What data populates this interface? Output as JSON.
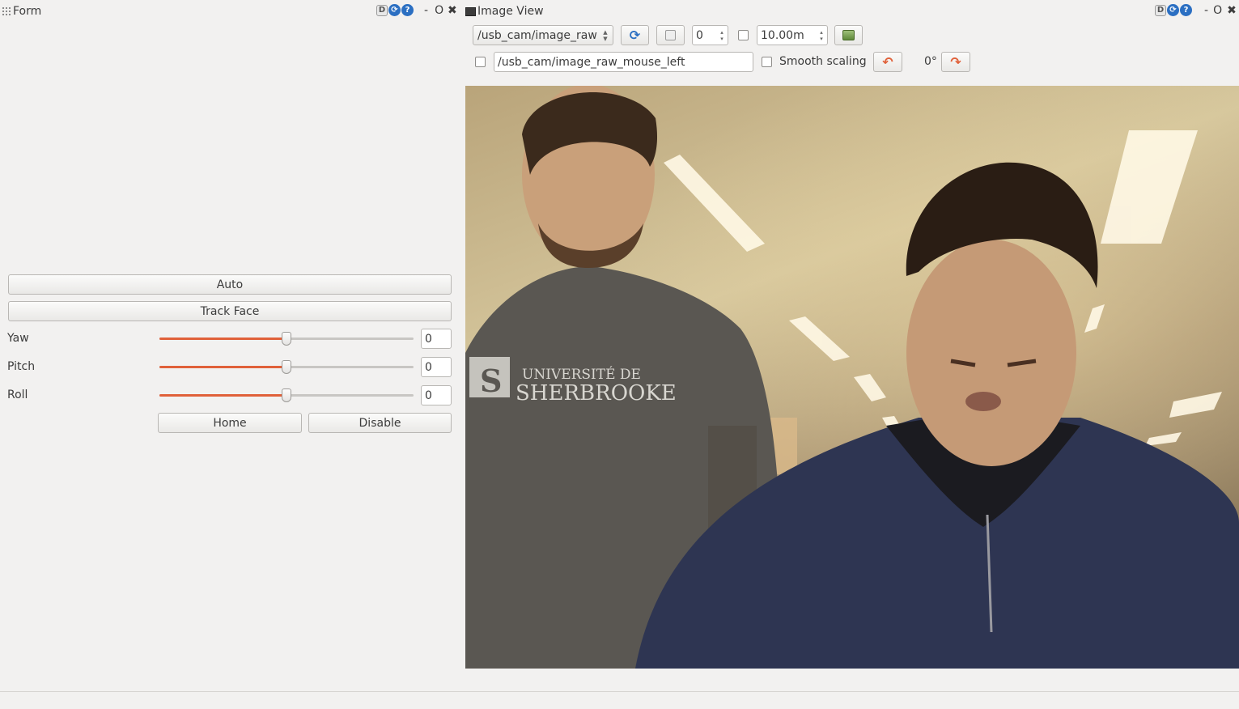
{
  "form_panel": {
    "title": "Form",
    "auto_label": "Auto",
    "track_face_label": "Track Face",
    "sliders": [
      {
        "label": "Yaw",
        "value": "0",
        "level": 0.5
      },
      {
        "label": "Pitch",
        "value": "0",
        "level": 0.5
      },
      {
        "label": "Roll",
        "value": "0",
        "level": 0.5
      }
    ],
    "home_label": "Home",
    "disable_label": "Disable"
  },
  "image_view": {
    "title": "Image View",
    "topic": "/usb_cam/image_raw",
    "index_value": "0",
    "duration_value": "10.00m",
    "mouse_topic": "/usb_cam/image_raw_mouse_left",
    "smooth_scaling_label": "Smooth scaling",
    "rotation_label": "0°",
    "camera_image": {
      "printed_text": "UNIVERSITÉ DE SHERBROOKE"
    }
  },
  "title_controls": {
    "d_icon": "D",
    "minimize": "-",
    "float": "O",
    "close": "✖"
  },
  "colors": {
    "accent": "#e0613a",
    "window_bg": "#f2f1f0",
    "help_icon": "#2b6fc2"
  }
}
